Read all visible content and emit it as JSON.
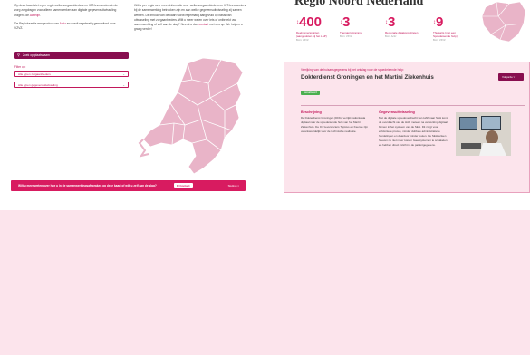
{
  "intro": {
    "p1_a": "Op deze kaart ziet u per regio welke zorgaanbieders en ICT-leveranciers in de zorg zorgdragen voor alleen samenwerken aan digitale gegevensuitwisseling volgens de",
    "p1_link": "Actielijn",
    "p2_a": "De Regiokaart is een product van",
    "p2_link": "Actiz",
    "p2_b": "en wordt regelmatig gemonitord door VZVZ."
  },
  "info": {
    "text": "Wilt u per regio over meer informatie over welke zorgaanbieders en ICT-leveranciers bij de samenwerking betrokken zijn en aan welke gegevensuitwisseling zij samen werken. De inhoud van de kaart wordt regelmatig aangevuld op basis van uitwisseling met zorgaanbieders. Wilt u meer weten over iets of ontbreekt uw samenwerking of zelf aan de slag? Neemt u dan",
    "link": "contact",
    "text2": "met ons op. We helpen u graag verder!"
  },
  "search": {
    "placeholder": "Zoek op plaatsnaam",
    "icon": "search-icon"
  },
  "filter": {
    "label": "Filter op:",
    "select1": "Alle typen zorgaanbieders",
    "select2": "Alle typen gegevensuitwisseling"
  },
  "banner": {
    "question": "Wilt u meer weten over hoe u in de samenwerkingsafspraken op deze kaart of wilt u zelf aan de slag?",
    "button": "Contact",
    "close": "Sluiting"
  },
  "region": {
    "title": "Regio Noord Nederland",
    "stats": [
      {
        "value": "400",
        "label": "Deelnemerspunten (aangesloten bij het LSP)",
        "source": "Bron: VZVZ"
      },
      {
        "value": "3",
        "label": "Themaprogramma",
        "source": "Bron: VZVZ"
      },
      {
        "value": "3",
        "label": "Regionale datakoppelingen",
        "source": "Bron: Actiz"
      },
      {
        "value": "9",
        "label": "Thuisarts (met een Spoedeisende hulp)",
        "source": "Bron: VZVZ"
      }
    ]
  },
  "card": {
    "small": "Verrijking van de huisartsgegevens bij het ontslag voor de spoedeisende hulp:",
    "title": "Dokterdienst Groningen en het Martini Ziekenhuis",
    "badge": "Gerealiseerd",
    "control": "Volgorde",
    "desc_title": "Beschrijving",
    "desc_text": "De Dokterdienst Groningen (DDG) verrijkt patiëntdata digitaal naar de spoedeisende hulp van het Martini Ziekenhuis. De ICT-leveranciers Topicus en Ksense zijn verantwoordelijk voor de technische realisatie.",
    "exch_title": "Gegevensuitwisseling",
    "exch_text": "Met de digitale spoedoverdracht van HAP naar SEH komt de overdracht van de HAP meteen na verwerking digitaal binnen in het systeem van de SEH. Dit zorgt voor efficiëntere proces, minder dubbele administratieve handelingen en daardoor minder fouten. De SEH-artsen hoeven nu niet meer tussen twee systemen te schakelen en hebben direct inzicht in de patiëntgegevens."
  },
  "colors": {
    "accent": "#d81b60",
    "dark": "#880e4f",
    "light": "#fce4ec",
    "badge": "#4caf50"
  }
}
